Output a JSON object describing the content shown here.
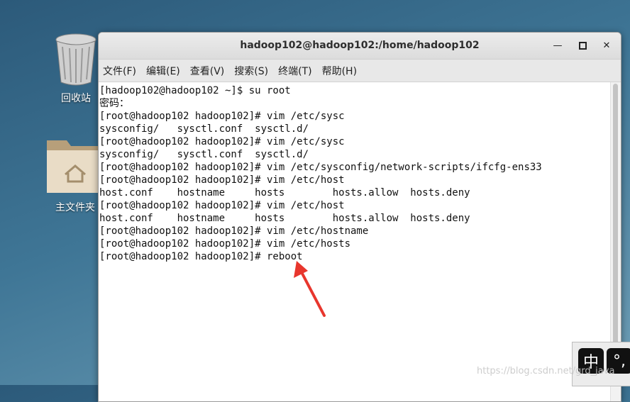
{
  "desktop": {
    "trash_label": "回收站",
    "home_label": "主文件夹"
  },
  "window": {
    "title": "hadoop102@hadoop102:/home/hadoop102",
    "menu": [
      "文件(F)",
      "编辑(E)",
      "查看(V)",
      "搜索(S)",
      "终端(T)",
      "帮助(H)"
    ]
  },
  "terminal": {
    "lines": [
      "[hadoop102@hadoop102 ~]$ su root",
      "密码：",
      "[root@hadoop102 hadoop102]# vim /etc/sysc",
      "sysconfig/   sysctl.conf  sysctl.d/",
      "[root@hadoop102 hadoop102]# vim /etc/sysc",
      "sysconfig/   sysctl.conf  sysctl.d/",
      "[root@hadoop102 hadoop102]# vim /etc/sysconfig/network-scripts/ifcfg-ens33",
      "[root@hadoop102 hadoop102]# vim /etc/host",
      "host.conf    hostname     hosts        hosts.allow  hosts.deny",
      "[root@hadoop102 hadoop102]# vim /etc/host",
      "host.conf    hostname     hosts        hosts.allow  hosts.deny",
      "[root@hadoop102 hadoop102]# vim /etc/hostname",
      "[root@hadoop102 hadoop102]# vim /etc/hosts",
      "[root@hadoop102 hadoop102]# reboot"
    ]
  },
  "ime": {
    "mode": "中",
    "punct": "°,"
  },
  "watermark": "https://blog.csdn.net/grd_java",
  "colors": {
    "arrow": "#e8362d",
    "desktop": "#3f7696"
  }
}
